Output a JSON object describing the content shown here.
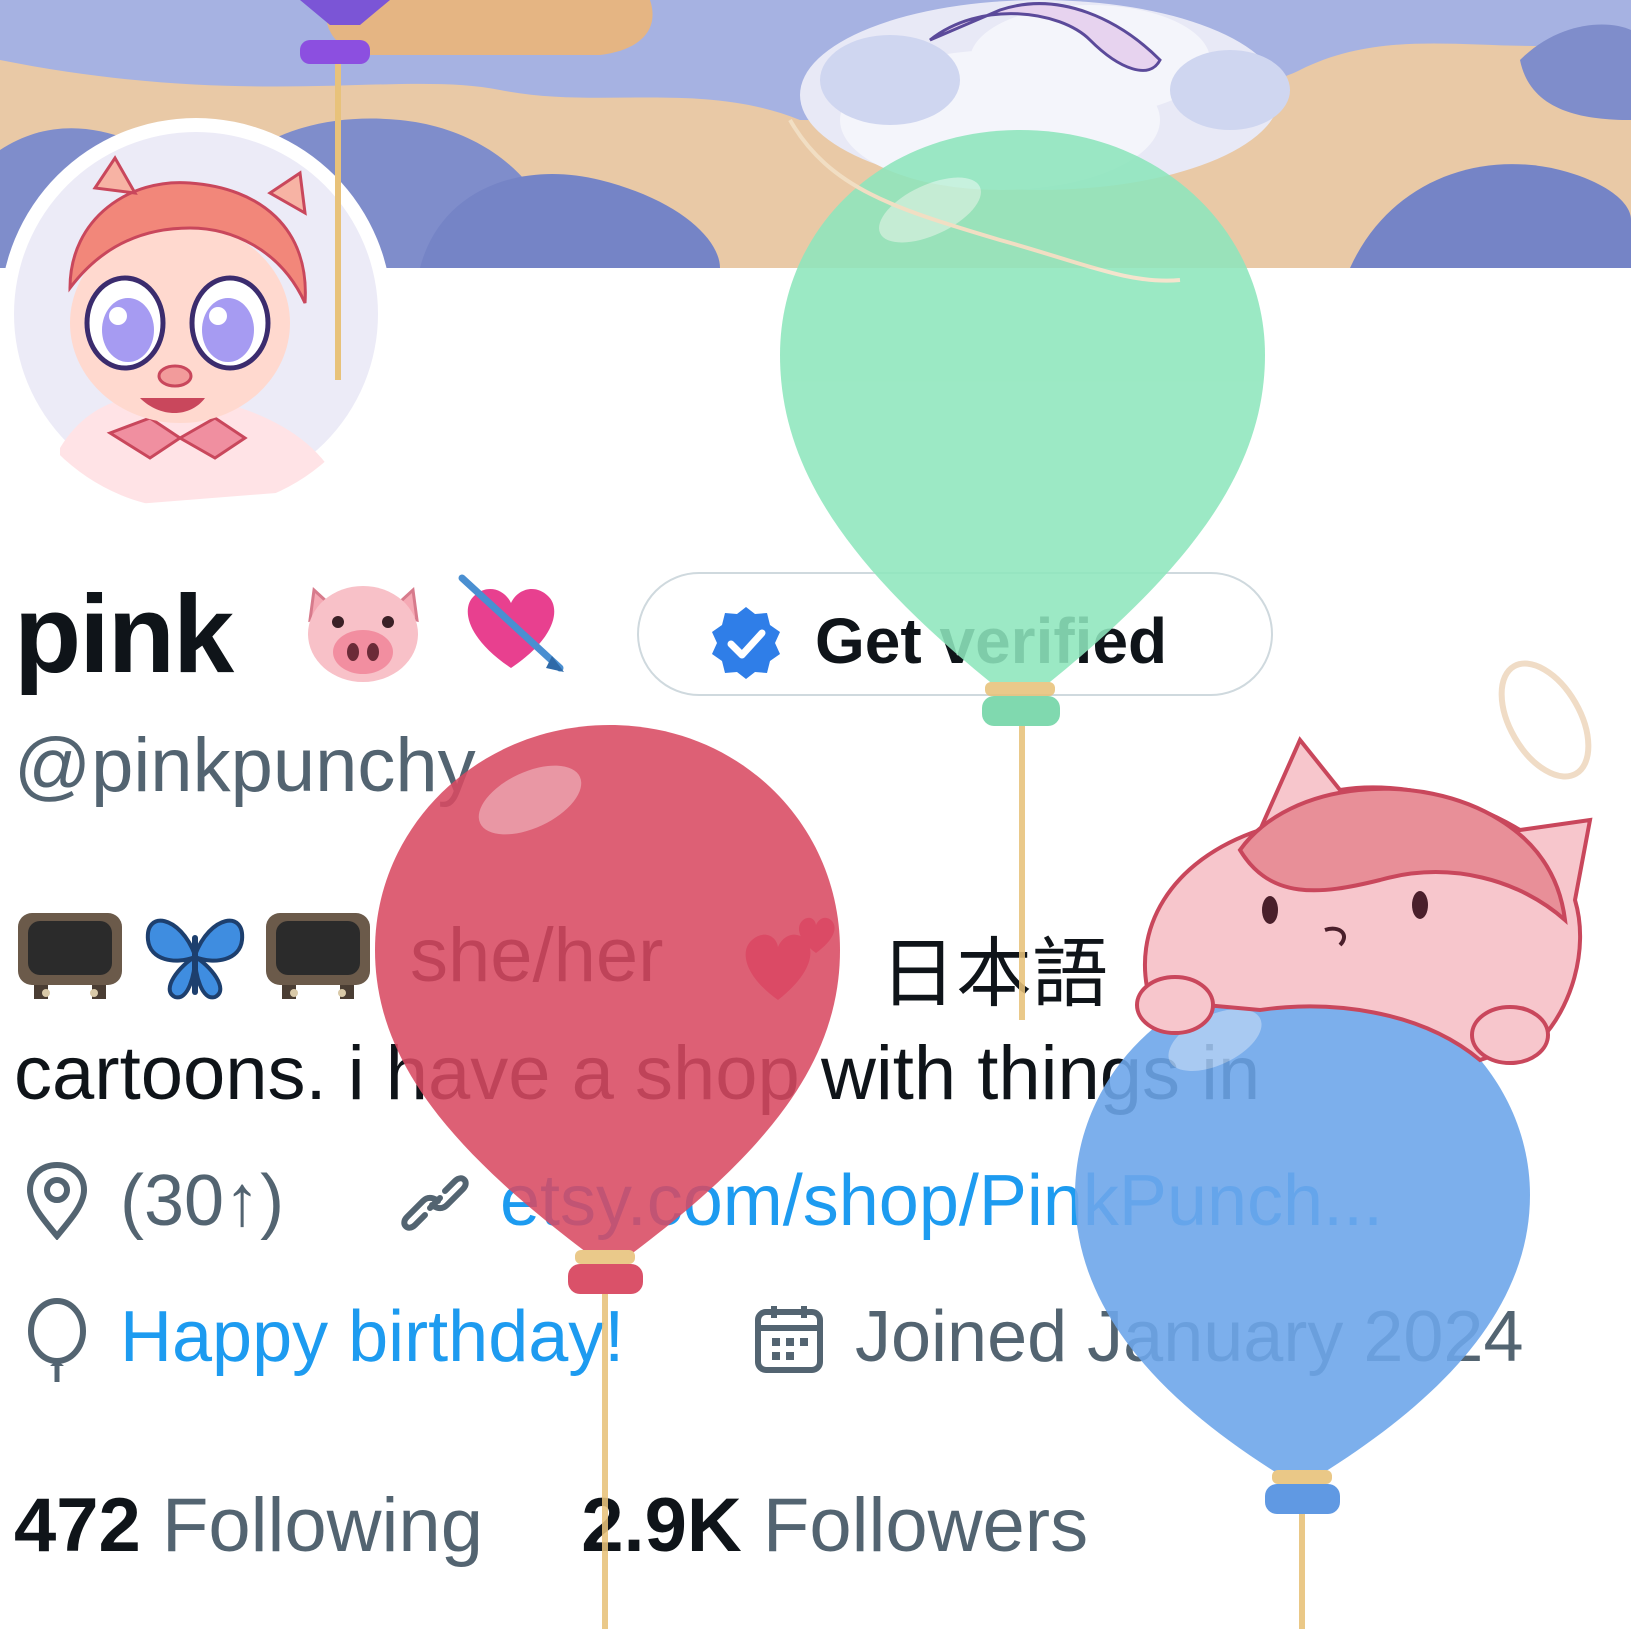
{
  "profile": {
    "name": "pink",
    "handle": "@pinkpunchy",
    "verify_button_label": "Get verified",
    "bio_line1_tag": "she/her",
    "bio_line1_lang": "日本語",
    "bio_line2": "cartoons. i have a shop with things in",
    "location": "(30↑)",
    "website": "etsy.com/shop/PinkPunch...",
    "birthday": "Happy birthday!",
    "joined": "Joined January 2024",
    "following_count": "472",
    "following_label": "Following",
    "followers_count": "2.9K",
    "followers_label": "Followers"
  },
  "icons": {
    "name_emojis": [
      "pig-face-icon",
      "heart-with-arrow-icon"
    ],
    "bio_emojis": [
      "tv-icon",
      "butterfly-icon",
      "tv-icon",
      "two-hearts-icon"
    ],
    "location": "location-pin-icon",
    "website": "link-icon",
    "birthday": "balloon-icon",
    "joined": "calendar-icon"
  },
  "colors": {
    "link": "#1d9bf0",
    "secondary_text": "#536471",
    "balloon_green": "#8ee6bd",
    "balloon_red": "#d94a62",
    "balloon_blue": "#6ea6ea"
  }
}
